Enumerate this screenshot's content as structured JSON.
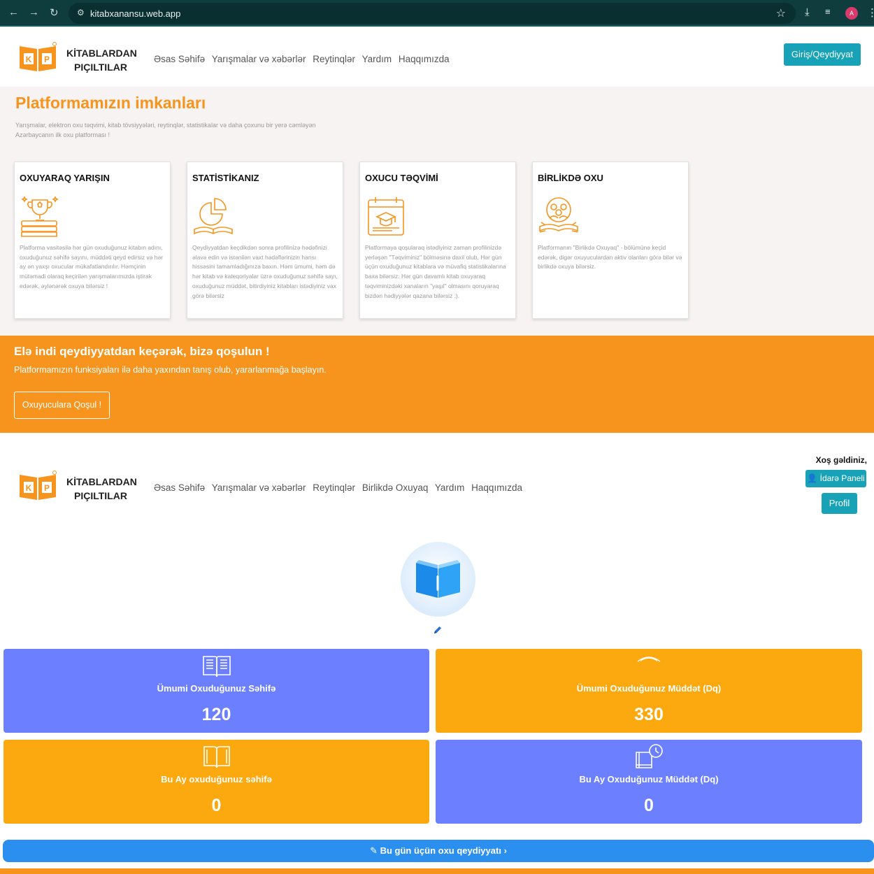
{
  "browser": {
    "url": "kitabxanansu.web.app",
    "avatar_letter": "A"
  },
  "brand": {
    "line1": "KİTABLARDAN",
    "line2": "PIÇILTILAR",
    "logo_letter1": "K",
    "logo_letter2": "P",
    "orange": "#f7941d",
    "teal": "#17a2b8"
  },
  "nav_guest": {
    "items": [
      "Əsas Səhifə",
      "Yarışmalar və xəbərlər",
      "Reytinqlər",
      "Yardım",
      "Haqqımızda"
    ],
    "login": "Giriş/Qeydiyyat"
  },
  "features": {
    "title": "Platformamızın imkanları",
    "subtitle": "Yarışmalar, elektron oxu təqvimi, kitab tövsiyyələri, reytinqlər, statistikalar və daha çoxunu bir yerə cəmləyən Azərbaycanın ilk oxu platforması !",
    "cards": [
      {
        "title": "OXUYARAQ YARIŞIN",
        "icon": "trophy-icon",
        "text": "Platforma vasitəsilə hər gün oxuduğunuz kitabın adını, oxuduğunuz səhifə sayını, müddəti qeyd edirsiz və hər ay ən yaxşı oxucular mükafatlandırılır. Həmçinin mütəmadi olaraq keçirilən yarışmalarımızda iştirak edərək, əylənərək oxuya bilərsiz !"
      },
      {
        "title": "STATİSTİKANIZ",
        "icon": "pie-chart-icon",
        "text": "Qeydiyyatdan keçdikdən sonra profilinizə hədəfinizi əlavə edin və istənilən vaxt hədəflərinizin hansı hissəsini tamamladığınıza baxın. Həm ümumi, həm də hər kitab və kateqoriyalar üzrə oxuduğunuz səhifə sayı, oxuduğunuz müddət, bitirdiyiniz kitabları istədiyiniz vax görə bilərsiz"
      },
      {
        "title": "OXUCU TƏQVİMİ",
        "icon": "calendar-icon",
        "text": "Platformaya qoşularaq istədiyiniz zaman profilinizdə yerləşən \"Təqviminiz\" bölməsinə daxil olub, Hər gün üçün oxuduğunuz kitablara və müvafiq statistikalarına baxa bilərsiz. Hər gün davamlı kitab oxuyaraq təqviminizdəki xanaların \"yaşıl\" olmasını qoruyaraq bizdən hədiyyələr qazana bilərsiz :)."
      },
      {
        "title": "BİRLİKDƏ OXU",
        "icon": "group-reading-icon",
        "text": "Platformanın \"Birlikdə Oxuyaq\" - bölümünə keçid edərək, digər oxuyuculardan aktiv olanları görə bilər və birlikdə oxuya bilərsiz."
      }
    ]
  },
  "cta": {
    "title": "Elə indi qeydiyyatdan keçərək, bizə qoşulun !",
    "text": "Platformamızın funksiyaları ilə daha yaxından tanış olub, yararlanmağa başlayın.",
    "button": "Oxuyuculara Qoşul !"
  },
  "nav_user": {
    "items": [
      "Əsas Səhifə",
      "Yarışmalar və xəbərlər",
      "Reytinqlər",
      "Birlikdə Oxuyaq",
      "Yardım",
      "Haqqımızda"
    ],
    "welcome": "Xoş gəldiniz,",
    "admin": "İdarə Paneli",
    "profile": "Profil"
  },
  "stats": [
    {
      "label": "Ümumi Oxuduğunuz Səhifə",
      "value": "120",
      "icon": "newspaper-book-icon",
      "color": "#6b7fff"
    },
    {
      "label": "Ümumi Oxuduğunuz Müddət (Dq)",
      "value": "330",
      "icon": "timer-icon",
      "color": "#fca80f"
    },
    {
      "label": "Bu Ay oxuduğunuz səhifə",
      "value": "0",
      "icon": "open-book-icon",
      "color": "#fca80f"
    },
    {
      "label": "Bu Ay Oxuduğunuz Müddət (Dq)",
      "value": "0",
      "icon": "book-clock-icon",
      "color": "#6b7fff"
    }
  ],
  "today_button": "Bu gün üçün oxu qeydiyyatı"
}
